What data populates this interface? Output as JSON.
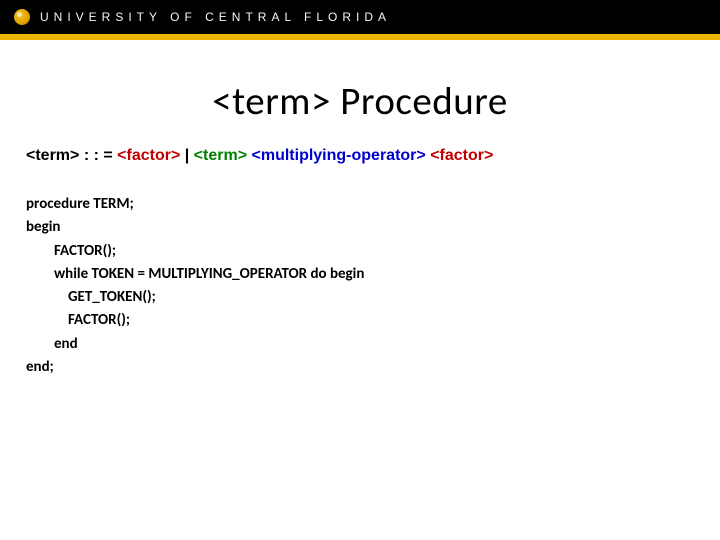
{
  "header": {
    "university": "UNIVERSITY OF CENTRAL FLORIDA"
  },
  "title": "<term> Procedure",
  "grammar": {
    "t1": "<term>",
    "eq": " : : = ",
    "t2": "<factor>",
    "pipe": " | ",
    "t3": "<term>",
    "sp1": " ",
    "t4": "<multiplying-operator>",
    "sp2": " ",
    "t5": "<factor>"
  },
  "code": {
    "l1": " procedure TERM;",
    "l2": "begin",
    "l3": "FACTOR();",
    "l4": "while TOKEN = MULTIPLYING_OPERATOR do begin",
    "l5": "GET_TOKEN();",
    "l6": "FACTOR();",
    "l7": "end",
    "l8": "end;"
  }
}
